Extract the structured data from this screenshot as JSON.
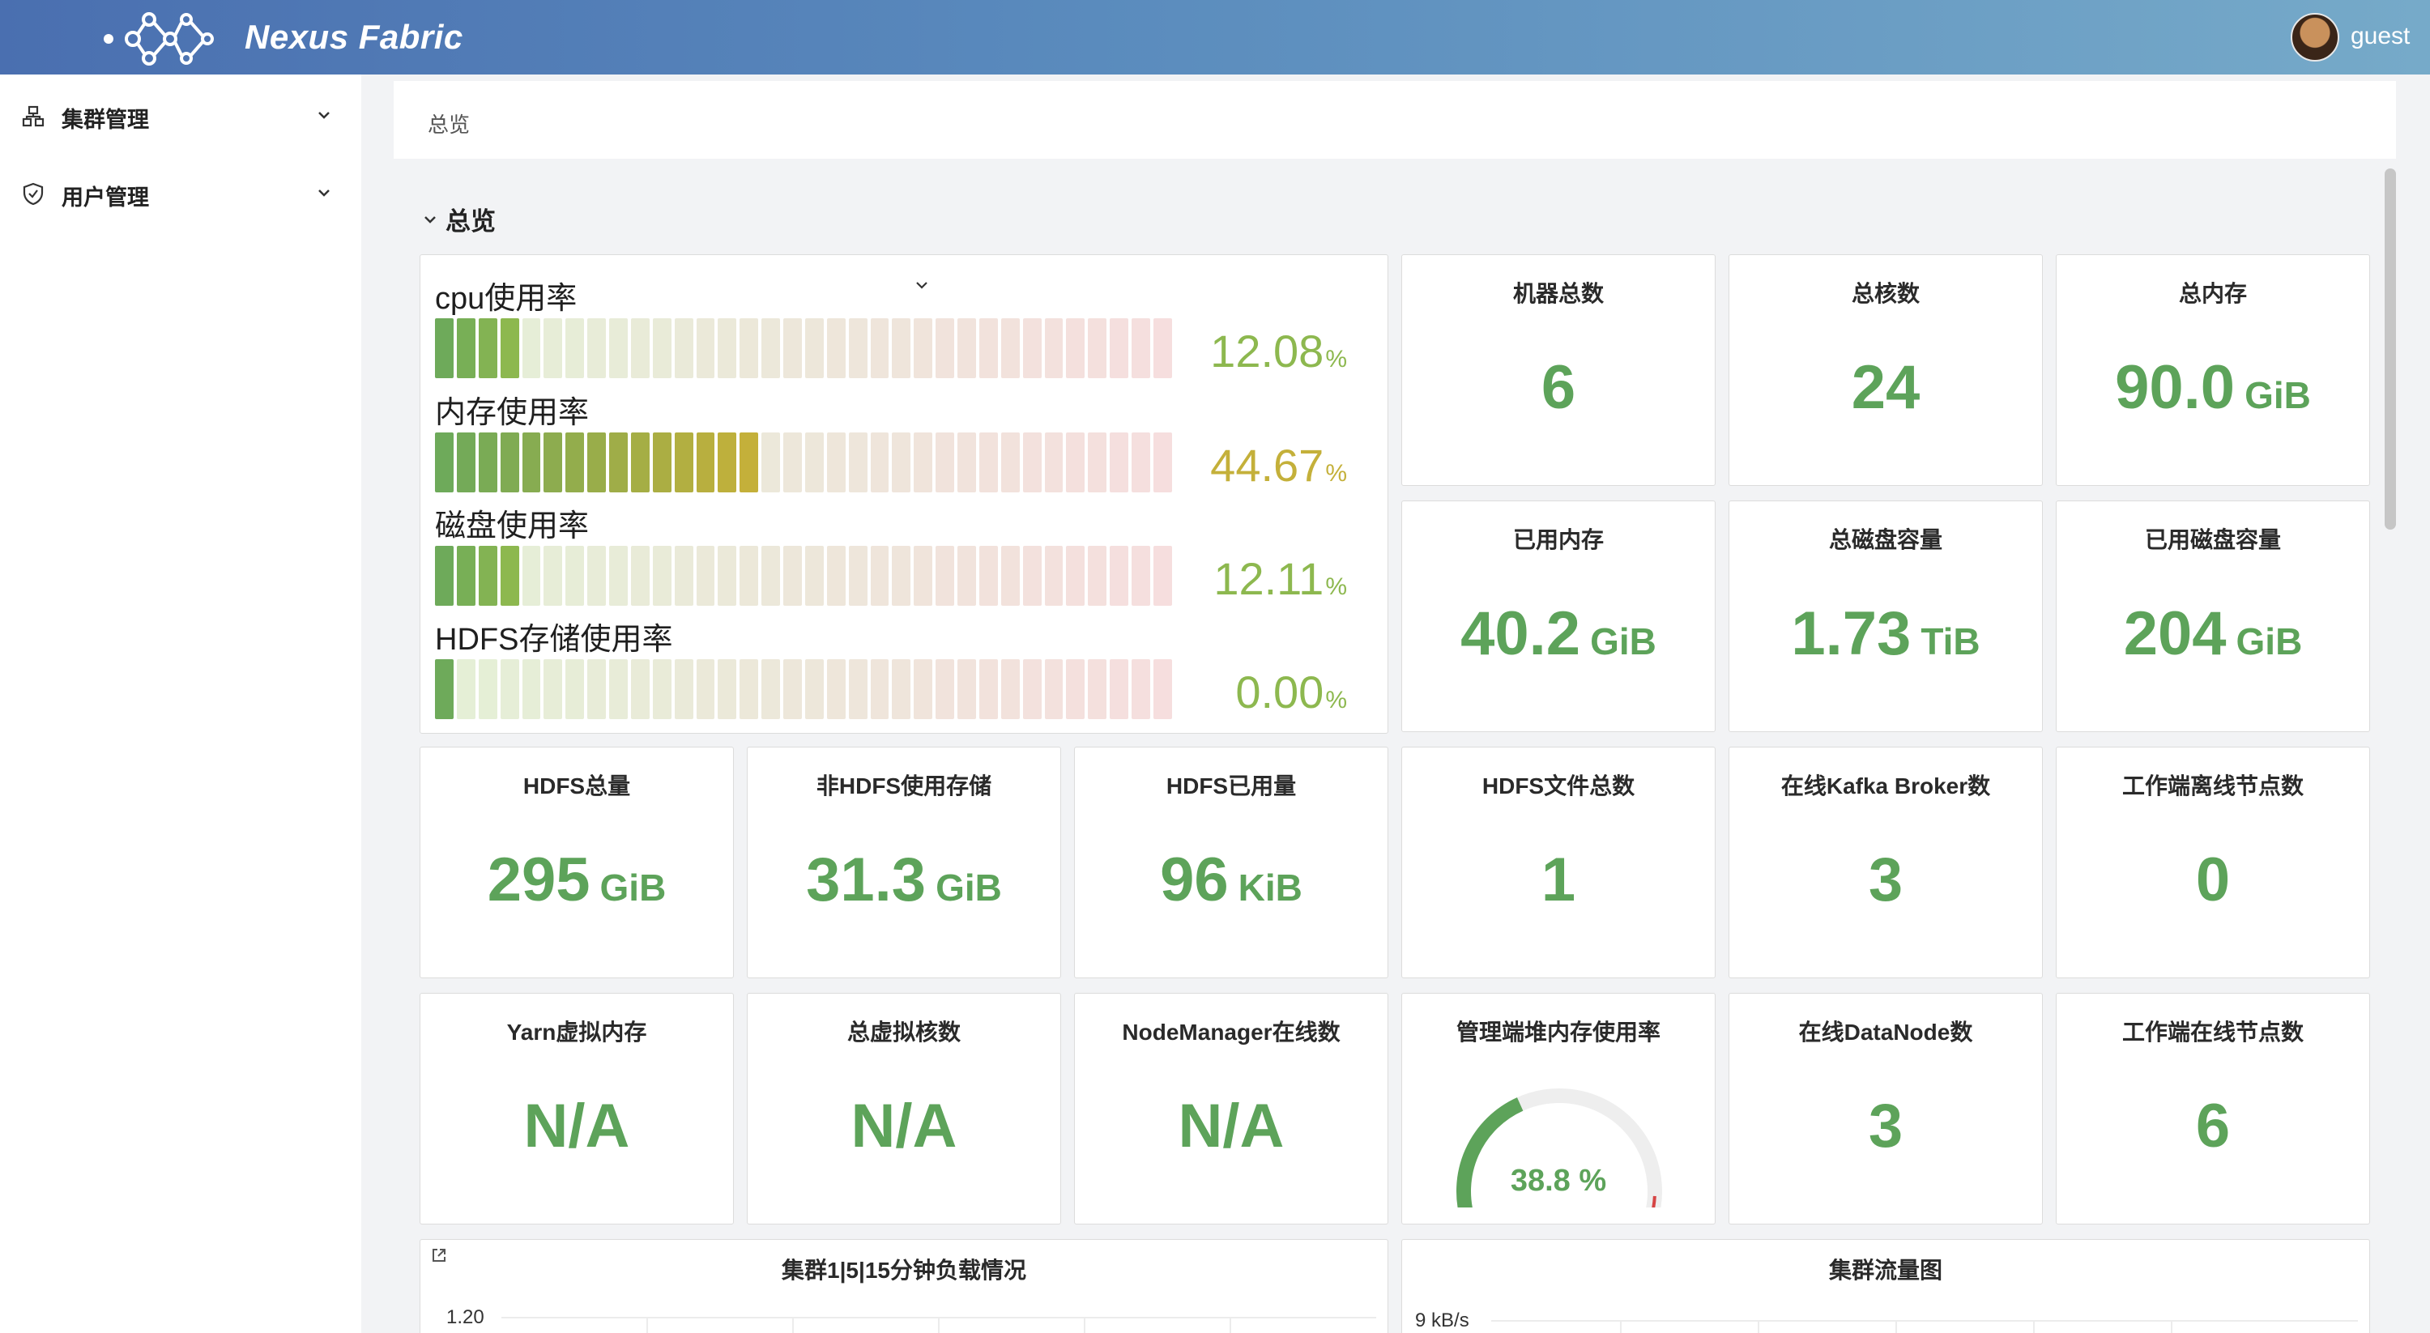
{
  "header": {
    "brand": "Nexus Fabric",
    "user": "guest"
  },
  "sidebar": {
    "items": [
      {
        "label": "集群管理",
        "icon": "cluster-icon"
      },
      {
        "label": "用户管理",
        "icon": "shield-icon"
      }
    ]
  },
  "breadcrumb": "总览",
  "section": {
    "title": "总览"
  },
  "usage": [
    {
      "label": "cpu使用率",
      "value": "12.08",
      "unit": "%",
      "fraction": 0.1208,
      "color": "#8db84f"
    },
    {
      "label": "内存使用率",
      "value": "44.67",
      "unit": "%",
      "fraction": 0.4467,
      "color": "#c4b03a"
    },
    {
      "label": "磁盘使用率",
      "value": "12.11",
      "unit": "%",
      "fraction": 0.1211,
      "color": "#8db84f"
    },
    {
      "label": "HDFS存储使用率",
      "value": "0.00",
      "unit": "%",
      "fraction": 0.0,
      "color": "#8db84f"
    }
  ],
  "stats": {
    "machines": {
      "title": "机器总数",
      "value": "6",
      "unit": ""
    },
    "cores": {
      "title": "总核数",
      "value": "24",
      "unit": ""
    },
    "memory": {
      "title": "总内存",
      "value": "90.0",
      "unit": "GiB"
    },
    "used_memory": {
      "title": "已用内存",
      "value": "40.2",
      "unit": "GiB"
    },
    "disk": {
      "title": "总磁盘容量",
      "value": "1.73",
      "unit": "TiB"
    },
    "used_disk": {
      "title": "已用磁盘容量",
      "value": "204",
      "unit": "GiB"
    },
    "hdfs_total": {
      "title": "HDFS总量",
      "value": "295",
      "unit": "GiB"
    },
    "non_hdfs": {
      "title": "非HDFS使用存储",
      "value": "31.3",
      "unit": "GiB"
    },
    "hdfs_used": {
      "title": "HDFS已用量",
      "value": "96",
      "unit": "KiB"
    },
    "hdfs_files": {
      "title": "HDFS文件总数",
      "value": "1",
      "unit": ""
    },
    "kafka": {
      "title": "在线Kafka Broker数",
      "value": "3",
      "unit": ""
    },
    "worker_offline": {
      "title": "工作端离线节点数",
      "value": "0",
      "unit": ""
    },
    "yarn_mem": {
      "title": "Yarn虚拟内存",
      "value": "N/A",
      "unit": ""
    },
    "vcores": {
      "title": "总虚拟核数",
      "value": "N/A",
      "unit": ""
    },
    "nodemanager": {
      "title": "NodeManager在线数",
      "value": "N/A",
      "unit": ""
    },
    "heap": {
      "title": "管理端堆内存使用率",
      "value": "38.8 %",
      "fraction": 0.388
    },
    "datanode": {
      "title": "在线DataNode数",
      "value": "3",
      "unit": ""
    },
    "worker_online": {
      "title": "工作端在线节点数",
      "value": "6",
      "unit": ""
    }
  },
  "charts": {
    "load": {
      "title": "集群1|5|15分钟负载情况",
      "y_tick": "1.20"
    },
    "traffic": {
      "title": "集群流量图",
      "y_tick": "9 kB/s"
    }
  },
  "colors": {
    "value_green": "#5da35a",
    "accent_yellow": "#c4b03a",
    "gauge_red": "#d64545"
  }
}
